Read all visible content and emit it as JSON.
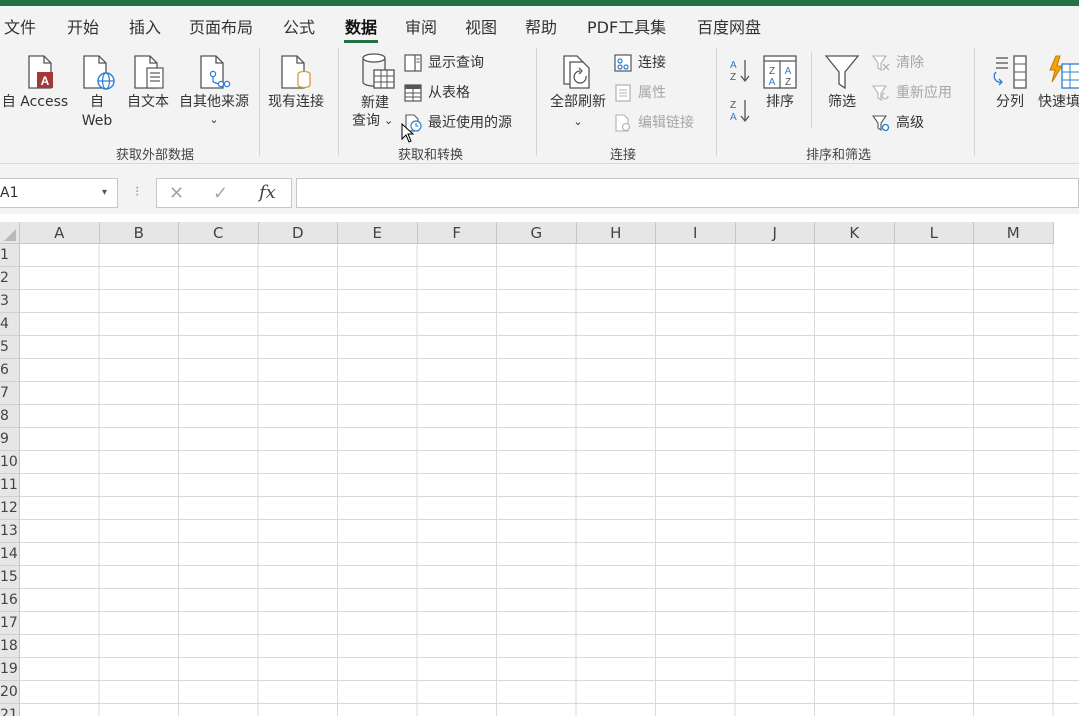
{
  "menu": {
    "tabs": [
      {
        "label": "文件"
      },
      {
        "label": "开始"
      },
      {
        "label": "插入"
      },
      {
        "label": "页面布局"
      },
      {
        "label": "公式"
      },
      {
        "label": "数据",
        "active": true
      },
      {
        "label": "审阅"
      },
      {
        "label": "视图"
      },
      {
        "label": "帮助"
      },
      {
        "label": "PDF工具集"
      },
      {
        "label": "百度网盘"
      }
    ]
  },
  "ribbon": {
    "external": {
      "access": "自 Access",
      "web_1": "自",
      "web_2": "Web",
      "text": "自文本",
      "other_sources": "自其他来源",
      "other_sources_arrow": "⌄",
      "existing": "现有连接",
      "group_label": "获取外部数据"
    },
    "transform": {
      "new_query_1": "新建",
      "new_query_2": "查询",
      "new_query_arrow": "⌄",
      "show_queries": "显示查询",
      "from_table": "从表格",
      "recent_sources": "最近使用的源",
      "group_label": "获取和转换"
    },
    "connections": {
      "refresh_all": "全部刷新",
      "refresh_arrow": "⌄",
      "connections": "连接",
      "properties": "属性",
      "edit_links": "编辑链接",
      "group_label": "连接"
    },
    "sort_filter": {
      "sort": "排序",
      "filter": "筛选",
      "clear": "清除",
      "reapply": "重新应用",
      "advanced": "高级",
      "group_label": "排序和筛选"
    },
    "tools": {
      "text_to_columns": "分列",
      "flash_fill": "快速填"
    }
  },
  "formula_bar": {
    "name_box": "A1",
    "name_box_arrow": "▾",
    "dots": "⁝",
    "cancel": "✕",
    "enter": "✓",
    "fx": "fx",
    "formula": ""
  },
  "sheet": {
    "columns": [
      "A",
      "B",
      "C",
      "D",
      "E",
      "F",
      "G",
      "H",
      "I",
      "J",
      "K",
      "L",
      "M"
    ],
    "rows": [
      "1",
      "2",
      "3",
      "4",
      "5",
      "6",
      "7",
      "8",
      "9",
      "10",
      "11",
      "12",
      "13",
      "14",
      "15",
      "16",
      "17",
      "18",
      "19",
      "20",
      "21"
    ]
  },
  "colors": {
    "accent": "#217346",
    "ribbon_bg": "#f3f3f3",
    "access_red": "#a4373a",
    "web_blue": "#2b7cd3",
    "orange": "#d99a3c"
  }
}
